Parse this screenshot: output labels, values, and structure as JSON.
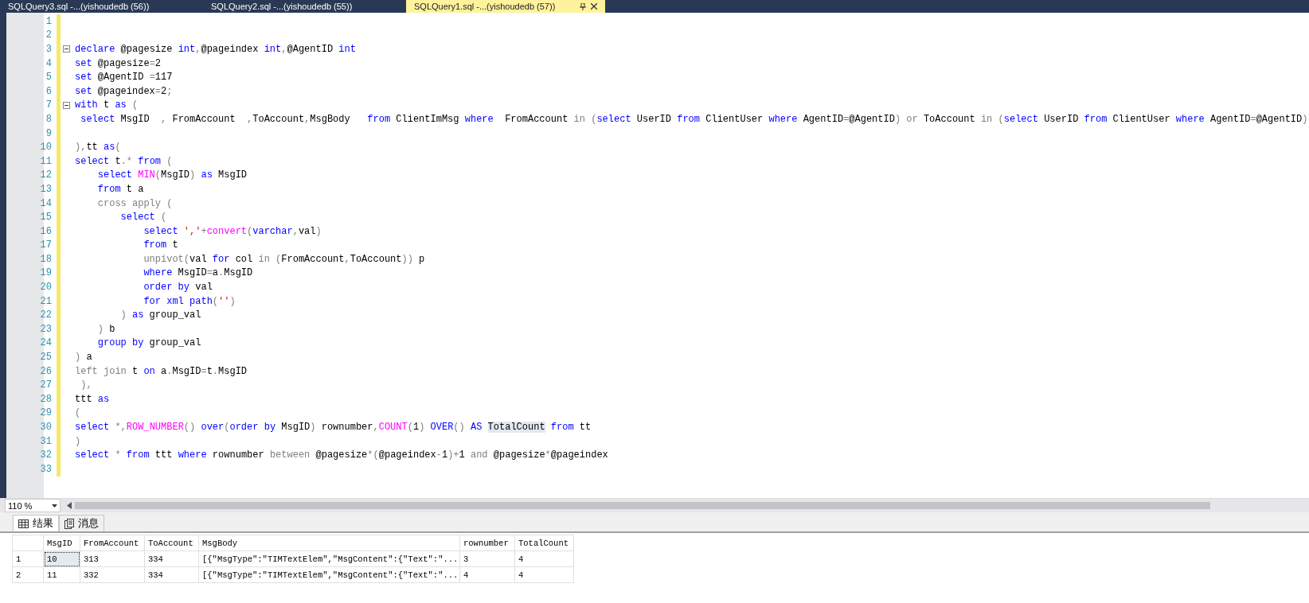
{
  "tabs": [
    {
      "label": "SQLQuery3.sql -...(yishoudedb (56))",
      "selected": false
    },
    {
      "label": "SQLQuery2.sql -...(yishoudedb (55))",
      "selected": false
    },
    {
      "label": "SQLQuery1.sql -...(yishoudedb (57))",
      "selected": true
    }
  ],
  "editor": {
    "lines": [
      {
        "number": "1"
      },
      {
        "number": "2"
      },
      {
        "number": "3",
        "fold": true,
        "segments": [
          {
            "kind": "kw",
            "text": "declare"
          },
          {
            "kind": "id",
            "text": " @pagesize "
          },
          {
            "kind": "kw",
            "text": "int"
          },
          {
            "kind": "op",
            "text": ","
          },
          {
            "kind": "id",
            "text": "@pageindex "
          },
          {
            "kind": "kw",
            "text": "int"
          },
          {
            "kind": "op",
            "text": ","
          },
          {
            "kind": "id",
            "text": "@AgentID "
          },
          {
            "kind": "kw",
            "text": "int"
          }
        ]
      },
      {
        "number": "4",
        "segments": [
          {
            "kind": "kw",
            "text": "set"
          },
          {
            "kind": "id",
            "text": " @pagesize"
          },
          {
            "kind": "op",
            "text": "="
          },
          {
            "kind": "id",
            "text": "2"
          }
        ]
      },
      {
        "number": "5",
        "segments": [
          {
            "kind": "kw",
            "text": "set"
          },
          {
            "kind": "id",
            "text": " @AgentID "
          },
          {
            "kind": "op",
            "text": "="
          },
          {
            "kind": "id",
            "text": "117"
          }
        ]
      },
      {
        "number": "6",
        "segments": [
          {
            "kind": "kw",
            "text": "set"
          },
          {
            "kind": "id",
            "text": " @pageindex"
          },
          {
            "kind": "op",
            "text": "="
          },
          {
            "kind": "id",
            "text": "2"
          },
          {
            "kind": "op",
            "text": ";"
          }
        ]
      },
      {
        "number": "7",
        "fold": true,
        "segments": [
          {
            "kind": "kw",
            "text": "with"
          },
          {
            "kind": "id",
            "text": " t "
          },
          {
            "kind": "kw",
            "text": "as"
          },
          {
            "kind": "op",
            "text": " ("
          }
        ]
      },
      {
        "number": "8",
        "segments": [
          {
            "kind": "kw",
            "text": " select"
          },
          {
            "kind": "id",
            "text": " MsgID  "
          },
          {
            "kind": "op",
            "text": ","
          },
          {
            "kind": "id",
            "text": " FromAccount  "
          },
          {
            "kind": "op",
            "text": ","
          },
          {
            "kind": "id",
            "text": "ToAccount"
          },
          {
            "kind": "op",
            "text": ","
          },
          {
            "kind": "id",
            "text": "MsgBody   "
          },
          {
            "kind": "kw",
            "text": "from"
          },
          {
            "kind": "id",
            "text": " ClientImMsg "
          },
          {
            "kind": "kw",
            "text": "where"
          },
          {
            "kind": "id",
            "text": "  FromAccount "
          },
          {
            "kind": "op",
            "text": "in ("
          },
          {
            "kind": "kw",
            "text": "select"
          },
          {
            "kind": "id",
            "text": " UserID "
          },
          {
            "kind": "kw",
            "text": "from"
          },
          {
            "kind": "id",
            "text": " ClientUser "
          },
          {
            "kind": "kw",
            "text": "where"
          },
          {
            "kind": "id",
            "text": " AgentID"
          },
          {
            "kind": "op",
            "text": "="
          },
          {
            "kind": "id",
            "text": "@AgentID"
          },
          {
            "kind": "op",
            "text": ") or"
          },
          {
            "kind": "id",
            "text": " ToAccount "
          },
          {
            "kind": "op",
            "text": "in ("
          },
          {
            "kind": "kw",
            "text": "select"
          },
          {
            "kind": "id",
            "text": " UserID "
          },
          {
            "kind": "kw",
            "text": "from"
          },
          {
            "kind": "id",
            "text": " ClientUser "
          },
          {
            "kind": "kw",
            "text": "where"
          },
          {
            "kind": "id",
            "text": " AgentID"
          },
          {
            "kind": "op",
            "text": "="
          },
          {
            "kind": "id",
            "text": "@AgentID"
          },
          {
            "kind": "op",
            "text": ")"
          }
        ]
      },
      {
        "number": "9"
      },
      {
        "number": "10",
        "segments": [
          {
            "kind": "op",
            "text": "),"
          },
          {
            "kind": "id",
            "text": "tt "
          },
          {
            "kind": "kw",
            "text": "as"
          },
          {
            "kind": "op",
            "text": "("
          }
        ]
      },
      {
        "number": "11",
        "segments": [
          {
            "kind": "kw",
            "text": "select"
          },
          {
            "kind": "id",
            "text": " t"
          },
          {
            "kind": "op",
            "text": ".*"
          },
          {
            "kind": "kw",
            "text": " from"
          },
          {
            "kind": "op",
            "text": " ("
          }
        ]
      },
      {
        "number": "12",
        "segments": [
          {
            "kind": "kw",
            "text": "    select"
          },
          {
            "kind": "fn",
            "text": " MIN"
          },
          {
            "kind": "op",
            "text": "("
          },
          {
            "kind": "id",
            "text": "MsgID"
          },
          {
            "kind": "op",
            "text": ")"
          },
          {
            "kind": "kw",
            "text": " as"
          },
          {
            "kind": "id",
            "text": " MsgID"
          }
        ]
      },
      {
        "number": "13",
        "segments": [
          {
            "kind": "kw",
            "text": "    from"
          },
          {
            "kind": "id",
            "text": " t a"
          }
        ]
      },
      {
        "number": "14",
        "segments": [
          {
            "kind": "op",
            "text": "    cross apply ("
          }
        ]
      },
      {
        "number": "15",
        "segments": [
          {
            "kind": "kw",
            "text": "        select"
          },
          {
            "kind": "op",
            "text": " ("
          }
        ]
      },
      {
        "number": "16",
        "segments": [
          {
            "kind": "kw",
            "text": "            select"
          },
          {
            "kind": "str",
            "text": " ','"
          },
          {
            "kind": "op",
            "text": "+"
          },
          {
            "kind": "fn",
            "text": "convert"
          },
          {
            "kind": "op",
            "text": "("
          },
          {
            "kind": "kw",
            "text": "varchar"
          },
          {
            "kind": "op",
            "text": ","
          },
          {
            "kind": "id",
            "text": "val"
          },
          {
            "kind": "op",
            "text": ")"
          }
        ]
      },
      {
        "number": "17",
        "segments": [
          {
            "kind": "kw",
            "text": "            from"
          },
          {
            "kind": "id",
            "text": " t"
          }
        ]
      },
      {
        "number": "18",
        "segments": [
          {
            "kind": "op",
            "text": "            unpivot("
          },
          {
            "kind": "id",
            "text": "val "
          },
          {
            "kind": "kw",
            "text": "for"
          },
          {
            "kind": "id",
            "text": " col "
          },
          {
            "kind": "op",
            "text": "in ("
          },
          {
            "kind": "id",
            "text": "FromAccount"
          },
          {
            "kind": "op",
            "text": ","
          },
          {
            "kind": "id",
            "text": "ToAccount"
          },
          {
            "kind": "op",
            "text": "))"
          },
          {
            "kind": "id",
            "text": " p"
          }
        ]
      },
      {
        "number": "19",
        "segments": [
          {
            "kind": "kw",
            "text": "            where"
          },
          {
            "kind": "id",
            "text": " MsgID"
          },
          {
            "kind": "op",
            "text": "="
          },
          {
            "kind": "id",
            "text": "a"
          },
          {
            "kind": "op",
            "text": "."
          },
          {
            "kind": "id",
            "text": "MsgID"
          }
        ]
      },
      {
        "number": "20",
        "segments": [
          {
            "kind": "kw",
            "text": "            order by"
          },
          {
            "kind": "id",
            "text": " val"
          }
        ]
      },
      {
        "number": "21",
        "segments": [
          {
            "kind": "kw",
            "text": "            for xml path"
          },
          {
            "kind": "op",
            "text": "("
          },
          {
            "kind": "str",
            "text": "''"
          },
          {
            "kind": "op",
            "text": ")"
          }
        ]
      },
      {
        "number": "22",
        "segments": [
          {
            "kind": "op",
            "text": "        )"
          },
          {
            "kind": "kw",
            "text": " as"
          },
          {
            "kind": "id",
            "text": " group_val"
          }
        ]
      },
      {
        "number": "23",
        "segments": [
          {
            "kind": "op",
            "text": "    )"
          },
          {
            "kind": "id",
            "text": " b"
          }
        ]
      },
      {
        "number": "24",
        "segments": [
          {
            "kind": "kw",
            "text": "    group by"
          },
          {
            "kind": "id",
            "text": " group_val"
          }
        ]
      },
      {
        "number": "25",
        "segments": [
          {
            "kind": "op",
            "text": ")"
          },
          {
            "kind": "id",
            "text": " a"
          }
        ]
      },
      {
        "number": "26",
        "segments": [
          {
            "kind": "op",
            "text": "left join"
          },
          {
            "kind": "id",
            "text": " t "
          },
          {
            "kind": "kw",
            "text": "on"
          },
          {
            "kind": "id",
            "text": " a"
          },
          {
            "kind": "op",
            "text": "."
          },
          {
            "kind": "id",
            "text": "MsgID"
          },
          {
            "kind": "op",
            "text": "="
          },
          {
            "kind": "id",
            "text": "t"
          },
          {
            "kind": "op",
            "text": "."
          },
          {
            "kind": "id",
            "text": "MsgID"
          }
        ]
      },
      {
        "number": "27",
        "segments": [
          {
            "kind": "op",
            "text": " ),"
          }
        ]
      },
      {
        "number": "28",
        "segments": [
          {
            "kind": "id",
            "text": "ttt "
          },
          {
            "kind": "kw",
            "text": "as"
          }
        ]
      },
      {
        "number": "29",
        "segments": [
          {
            "kind": "op",
            "text": "("
          }
        ]
      },
      {
        "number": "30",
        "segments": [
          {
            "kind": "kw",
            "text": "select"
          },
          {
            "kind": "op",
            "text": " *,"
          },
          {
            "kind": "fn",
            "text": "ROW_NUMBER"
          },
          {
            "kind": "op",
            "text": "()"
          },
          {
            "kind": "kw",
            "text": " over"
          },
          {
            "kind": "op",
            "text": "("
          },
          {
            "kind": "kw",
            "text": "order by"
          },
          {
            "kind": "id",
            "text": " MsgID"
          },
          {
            "kind": "op",
            "text": ")"
          },
          {
            "kind": "id",
            "text": " rownumber"
          },
          {
            "kind": "op",
            "text": ","
          },
          {
            "kind": "fn",
            "text": "COUNT"
          },
          {
            "kind": "op",
            "text": "("
          },
          {
            "kind": "id",
            "text": "1"
          },
          {
            "kind": "op",
            "text": ")"
          },
          {
            "kind": "kw",
            "text": " OVER"
          },
          {
            "kind": "op",
            "text": "()"
          },
          {
            "kind": "kw",
            "text": " AS "
          },
          {
            "kind": "hl",
            "text": "TotalCount"
          },
          {
            "kind": "kw",
            "text": " from"
          },
          {
            "kind": "id",
            "text": " tt"
          }
        ]
      },
      {
        "number": "31",
        "segments": [
          {
            "kind": "op",
            "text": ")"
          }
        ]
      },
      {
        "number": "32",
        "segments": [
          {
            "kind": "kw",
            "text": "select"
          },
          {
            "kind": "op",
            "text": " *"
          },
          {
            "kind": "kw",
            "text": " from"
          },
          {
            "kind": "id",
            "text": " ttt "
          },
          {
            "kind": "kw",
            "text": "where"
          },
          {
            "kind": "id",
            "text": " rownumber "
          },
          {
            "kind": "op",
            "text": "between"
          },
          {
            "kind": "id",
            "text": " @pagesize"
          },
          {
            "kind": "op",
            "text": "*("
          },
          {
            "kind": "id",
            "text": "@pageindex"
          },
          {
            "kind": "op",
            "text": "-"
          },
          {
            "kind": "id",
            "text": "1"
          },
          {
            "kind": "op",
            "text": ")+"
          },
          {
            "kind": "id",
            "text": "1 "
          },
          {
            "kind": "op",
            "text": "and"
          },
          {
            "kind": "id",
            "text": " @pagesize"
          },
          {
            "kind": "op",
            "text": "*"
          },
          {
            "kind": "id",
            "text": "@pageindex"
          }
        ]
      },
      {
        "number": "33"
      }
    ]
  },
  "zoom": {
    "value": "110 %"
  },
  "result_tabs": [
    {
      "label": "结果",
      "kind": "grid",
      "selected": true
    },
    {
      "label": "消息",
      "kind": "messages",
      "selected": false
    }
  ],
  "results": {
    "columns": [
      "MsgID",
      "FromAccount",
      "ToAccount",
      "MsgBody",
      "rownumber",
      "TotalCount"
    ],
    "rows": [
      {
        "number": "1",
        "cells": [
          {
            "text": "10",
            "focused": true
          },
          {
            "text": "313",
            "focused": false
          },
          {
            "text": "334",
            "focused": false
          },
          {
            "text": "[{\"MsgType\":\"TIMTextElem\",\"MsgContent\":{\"Text\":\"...",
            "focused": false
          },
          {
            "text": "3",
            "focused": false
          },
          {
            "text": "4",
            "focused": false
          }
        ]
      },
      {
        "number": "2",
        "cells": [
          {
            "text": "11",
            "focused": false
          },
          {
            "text": "332",
            "focused": false
          },
          {
            "text": "334",
            "focused": false
          },
          {
            "text": "[{\"MsgType\":\"TIMTextElem\",\"MsgContent\":{\"Text\":\"...",
            "focused": false
          },
          {
            "text": "4",
            "focused": false
          },
          {
            "text": "4",
            "focused": false
          }
        ]
      }
    ]
  }
}
